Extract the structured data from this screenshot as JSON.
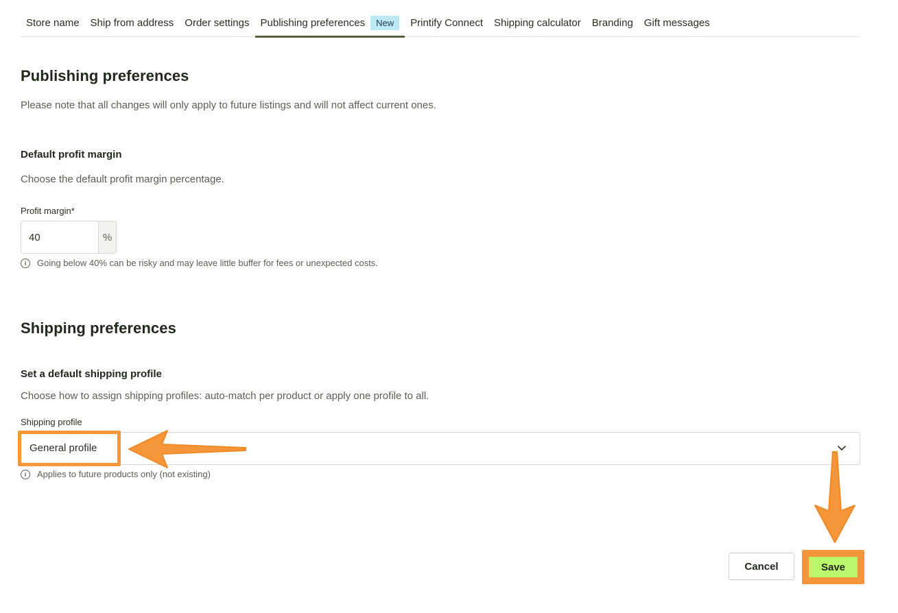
{
  "tabs": [
    {
      "label": "Store name"
    },
    {
      "label": "Ship from address"
    },
    {
      "label": "Order settings"
    },
    {
      "label": "Publishing preferences",
      "badge": "New",
      "active": true
    },
    {
      "label": "Printify Connect"
    },
    {
      "label": "Shipping calculator"
    },
    {
      "label": "Branding"
    },
    {
      "label": "Gift messages"
    }
  ],
  "publishing": {
    "title": "Publishing preferences",
    "note": "Please note that all changes will only apply to future listings and will not affect current ones.",
    "margin_section_title": "Default profit margin",
    "margin_section_desc": "Choose the default profit margin percentage.",
    "profit_label": "Profit margin",
    "required_marker": "*",
    "profit_value": "40",
    "profit_suffix": "%",
    "profit_hint": "Going below 40% can be risky and may leave little buffer for fees or unexpected costs."
  },
  "shipping": {
    "title": "Shipping preferences",
    "subsection_title": "Set a default shipping profile",
    "subsection_desc": "Choose how to assign shipping profiles: auto-match per product or apply one profile to all.",
    "profile_label": "Shipping profile",
    "profile_value": "General profile",
    "profile_hint": "Applies to future products only (not existing)"
  },
  "actions": {
    "cancel_label": "Cancel",
    "save_label": "Save"
  },
  "colors": {
    "accent": "#56623f",
    "badge_bg": "#bde9f7",
    "save_bg": "#b9f76a",
    "annotation": "#f5963a"
  },
  "icons": {
    "info": "info-icon",
    "chevron": "chevron-down-icon"
  }
}
